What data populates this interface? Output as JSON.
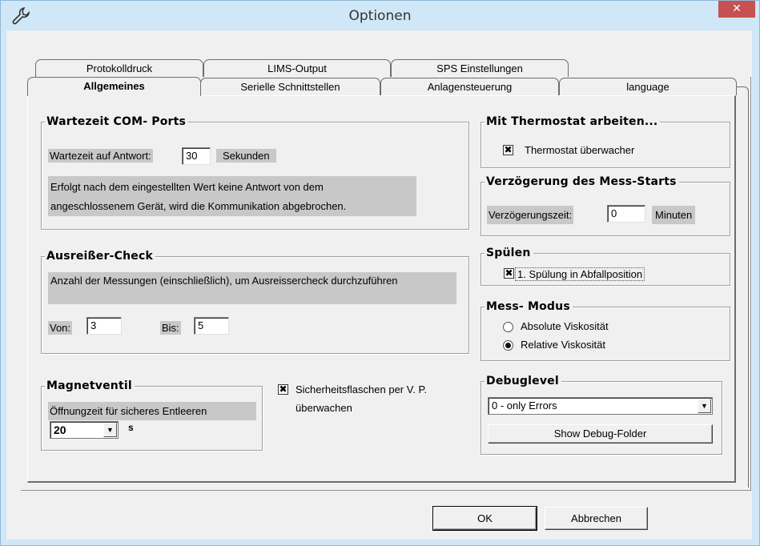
{
  "window": {
    "title": "Optionen",
    "close_label": "✕"
  },
  "tabs_back": [
    "Protokolldruck",
    "LIMS-Output",
    "SPS Einstellungen"
  ],
  "tabs_front": [
    "Allgemeines",
    "Serielle Schnittstellen",
    "Anlagensteuerung",
    "language"
  ],
  "com_ports": {
    "title": "Wartezeit COM- Ports",
    "wait_label": "Wartezeit auf Antwort:",
    "wait_value": "30",
    "unit": "Sekunden",
    "desc_line1": "Erfolgt nach dem eingestellten Wert keine Antwort  von dem",
    "desc_line2": "angeschlossenem Gerät, wird die Kommunikation abgebrochen."
  },
  "outlier": {
    "title": "Ausreißer-Check",
    "desc": "Anzahl der Messungen (einschließlich), um Ausreissercheck durchzuführen",
    "from_label": "Von:",
    "from_value": "3",
    "to_label": "Bis:",
    "to_value": "5"
  },
  "valve": {
    "title": "Magnetventil",
    "desc": "Öffnungzeit für sicheres Entleeren",
    "value": "20",
    "unit": "s"
  },
  "safety": {
    "label_line1": "Sicherheitsflaschen per V. P.",
    "label_line2": "überwachen",
    "checked": true
  },
  "thermostat": {
    "title": "Mit Thermostat arbeiten...",
    "label": "Thermostat überwacher",
    "checked": true
  },
  "delay": {
    "title": "Verzögerung des Mess-Starts",
    "label": "Verzögerungszeit:",
    "value": "0",
    "unit": "Minuten"
  },
  "rinse": {
    "title": "Spülen",
    "label": "1. Spülung in Abfallposition",
    "checked": true
  },
  "mode": {
    "title": "Mess- Modus",
    "options": [
      "Absolute Viskosität",
      "Relative Viskosität"
    ],
    "selected": "Relative Viskosität"
  },
  "debug": {
    "title": "Debuglevel",
    "value": "0 - only Errors",
    "button": "Show Debug-Folder"
  },
  "footer": {
    "ok": "OK",
    "cancel": "Abbrechen"
  },
  "check_mark": "✖"
}
